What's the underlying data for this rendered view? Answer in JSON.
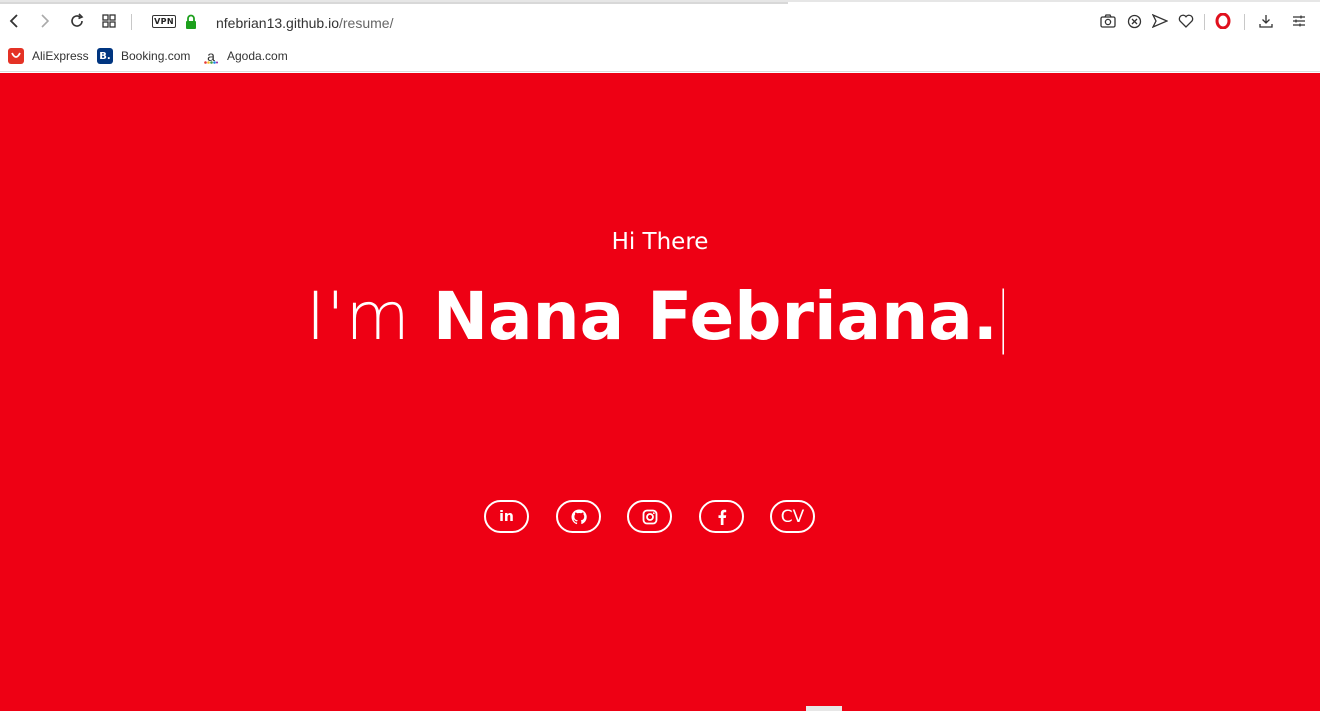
{
  "browser": {
    "url_host": "nfebrian13.github.io",
    "url_path": "/resume/",
    "vpn_label": "VPN"
  },
  "bookmarks": [
    {
      "label": "AliExpress",
      "icon": "aliexpress-icon",
      "color": "#e43225"
    },
    {
      "label": "Booking.com",
      "icon": "booking-icon",
      "icon_text": "B.",
      "color": "#003580"
    },
    {
      "label": "Agoda.com",
      "icon": "agoda-icon",
      "icon_text": "a",
      "color": "#ffffff"
    }
  ],
  "hero": {
    "greeting": "Hi There",
    "intro": "I'm ",
    "name": "Nana Febriana.",
    "cursor": "|",
    "background_color": "#ee0014"
  },
  "social": {
    "linkedin_text": "in",
    "cv_label": "CV",
    "icons": [
      "linkedin-icon",
      "github-icon",
      "instagram-icon",
      "facebook-icon"
    ]
  }
}
